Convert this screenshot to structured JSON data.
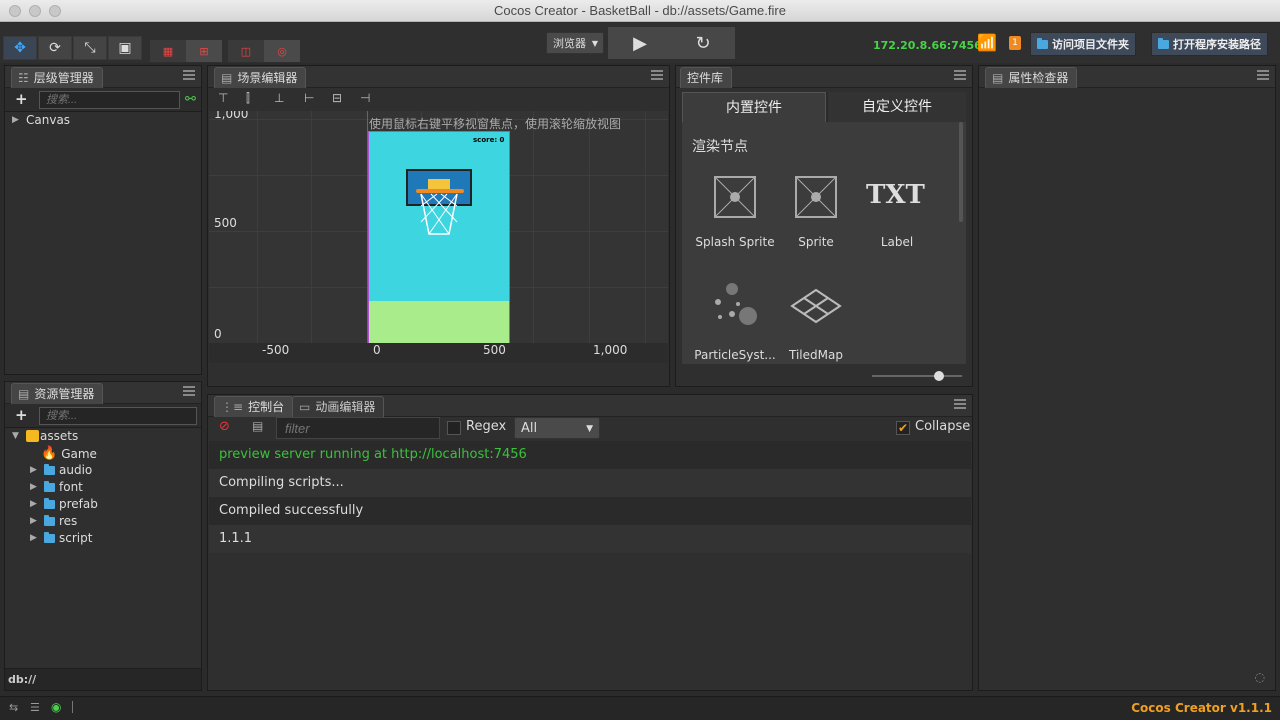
{
  "window": {
    "title": "Cocos Creator - BasketBall - db://assets/Game.fire"
  },
  "toolbar": {
    "platform_select": "浏览器",
    "ip_address": "172.20.8.66:7456",
    "notification_count": "1",
    "open_project_folder": "访问项目文件夹",
    "open_install_path": "打开程序安装路径"
  },
  "hierarchy": {
    "title": "层级管理器",
    "search_placeholder": "搜索...",
    "root": "Canvas"
  },
  "scene": {
    "title": "场景编辑器",
    "hint": "使用鼠标右键平移视窗焦点，使用滚轮缩放视图",
    "y_labels": [
      "1,000",
      "500",
      "0"
    ],
    "x_labels": [
      "-500",
      "0",
      "500",
      "1,000"
    ],
    "score_label": "score: 0"
  },
  "widgets": {
    "title": "控件库",
    "tab_builtin": "内置控件",
    "tab_custom": "自定义控件",
    "section": "渲染节点",
    "txt_icon": "TXT",
    "items": [
      "Splash Sprite",
      "Sprite",
      "Label",
      "ParticleSyst...",
      "TiledMap"
    ]
  },
  "inspector": {
    "title": "属性检查器"
  },
  "assets": {
    "title": "资源管理器",
    "search_placeholder": "搜索...",
    "root": "assets",
    "items": [
      "Game",
      "audio",
      "font",
      "prefab",
      "res",
      "script"
    ],
    "footer": "db://"
  },
  "console": {
    "tab_console": "控制台",
    "tab_animation": "动画编辑器",
    "filter_placeholder": "filter",
    "regex_label": "Regex",
    "level_select": "All",
    "collapse_label": "Collapse",
    "lines": [
      {
        "text": "preview server running at http://localhost:7456",
        "color": "#3cc13c"
      },
      {
        "text": "Compiling scripts...",
        "color": "#dddddd"
      },
      {
        "text": "Compiled successfully",
        "color": "#dddddd"
      },
      {
        "text": "1.1.1",
        "color": "#dddddd"
      }
    ]
  },
  "status": {
    "version": "Cocos Creator v1.1.1"
  },
  "colors": {
    "accent": "#3da8ff",
    "version": "#f0a020",
    "online": "#4ad14a",
    "game_sky": "#3dd6e0",
    "game_grass": "#a8ec8c"
  }
}
